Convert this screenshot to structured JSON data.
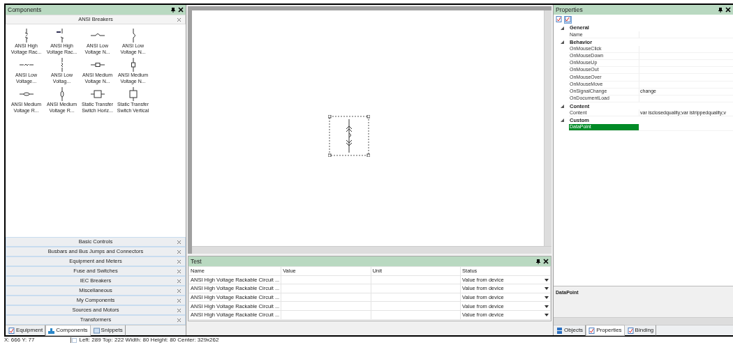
{
  "components_panel": {
    "title": "Components",
    "sections": [
      {
        "label": "ANSI Breakers",
        "expanded": true,
        "items": [
          {
            "label": "ANSI High\nVoltage Rac..."
          },
          {
            "label": "ANSI High\nVoltage Rac..."
          },
          {
            "label": "ANSI Low\nVoltage N..."
          },
          {
            "label": "ANSI Low\nVoltage N..."
          },
          {
            "label": "ANSI Low\nVoltage..."
          },
          {
            "label": "ANSI Low\nVoltag..."
          },
          {
            "label": "ANSI Medium\nVoltage N..."
          },
          {
            "label": "ANSI Medium\nVoltage N..."
          },
          {
            "label": "ANSI Medium\nVoltage R..."
          },
          {
            "label": "ANSI Medium\nVoltage R..."
          },
          {
            "label": "Static Transfer\nSwitch Horiz..."
          },
          {
            "label": "Static Transfer\nSwitch Vertical"
          }
        ]
      },
      {
        "label": "Basic Controls",
        "expanded": false
      },
      {
        "label": "Busbars and Bus Jumps and Connectors",
        "expanded": false
      },
      {
        "label": "Equipment and Meters",
        "expanded": false
      },
      {
        "label": "Fuse and Switches",
        "expanded": false
      },
      {
        "label": "IEC Breakers",
        "expanded": false
      },
      {
        "label": "Miscellaneous",
        "expanded": false
      },
      {
        "label": "My Components",
        "expanded": false
      },
      {
        "label": "Sources and Motors",
        "expanded": false
      },
      {
        "label": "Transformers",
        "expanded": false
      }
    ],
    "tabs": [
      {
        "label": "Equipment",
        "selected": false
      },
      {
        "label": "Components",
        "selected": true
      },
      {
        "label": "Snippets",
        "selected": false
      }
    ]
  },
  "canvas": {
    "shape": {
      "selected": true
    }
  },
  "test_panel": {
    "title": "Test",
    "columns": [
      "Name",
      "Value",
      "Unit",
      "Status"
    ],
    "rows": [
      {
        "name": "ANSI High Voltage Rackable Circuit ...",
        "status": "Value from device"
      },
      {
        "name": "ANSI High Voltage Rackable Circuit ...",
        "status": "Value from device"
      },
      {
        "name": "ANSI High Voltage Rackable Circuit ...",
        "status": "Value from device"
      },
      {
        "name": "ANSI High Voltage Rackable Circuit ...",
        "status": "Value from device"
      },
      {
        "name": "ANSI High Voltage Rackable Circuit ...",
        "status": "Value from device"
      }
    ]
  },
  "properties_panel": {
    "title": "Properties",
    "categories": [
      {
        "name": "General",
        "expanded": true,
        "properties": [
          {
            "name": "Name",
            "selected": false
          }
        ]
      },
      {
        "name": "Behavior",
        "expanded": true,
        "properties": [
          {
            "name": "OnMouseClick",
            "selected": false
          },
          {
            "name": "OnMouseDown",
            "selected": false
          },
          {
            "name": "OnMouseUp",
            "selected": false
          },
          {
            "name": "OnMouseOut",
            "selected": false
          },
          {
            "name": "OnMouseOver",
            "selected": false
          },
          {
            "name": "OnMouseMove",
            "selected": false
          },
          {
            "name": "OnSignalChange",
            "value": "change",
            "selected": false
          },
          {
            "name": "OnDocumentLoad",
            "selected": false
          }
        ]
      },
      {
        "name": "Content",
        "expanded": true,
        "properties": [
          {
            "name": "Content",
            "value": "var isclosedquality;var istrippedquality;v",
            "selected": false
          }
        ]
      },
      {
        "name": "Custom",
        "expanded": true,
        "properties": [
          {
            "name": "DataPoint",
            "selected": true
          }
        ]
      }
    ],
    "description": "DataPoint",
    "tabs": [
      {
        "label": "Objects",
        "selected": false
      },
      {
        "label": "Properties",
        "selected": true
      },
      {
        "label": "Binding",
        "selected": false
      }
    ]
  },
  "status_bar": {
    "cursor": "X: 666  Y: 77",
    "selection": "Left: 289  Top: 222  Width: 80  Height: 80  Center: 329x262"
  }
}
